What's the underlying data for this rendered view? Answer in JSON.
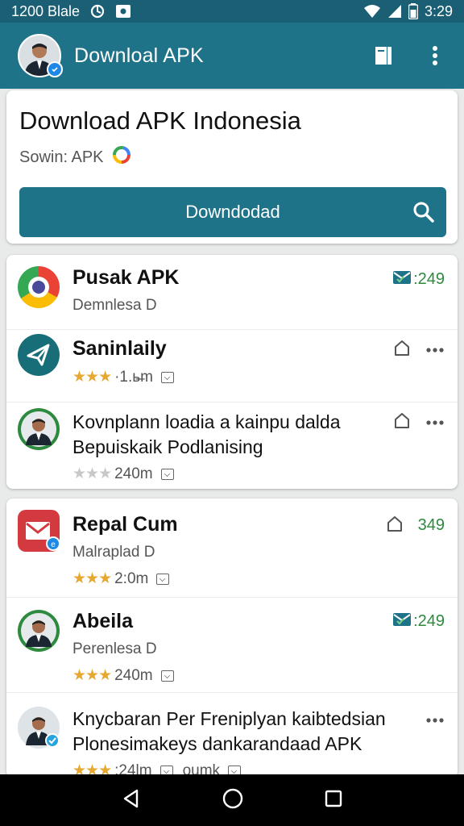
{
  "status": {
    "time_left": "1200 Blale",
    "time": "3:29"
  },
  "appbar": {
    "title": "Downloal APK"
  },
  "header": {
    "title": "Download APK Indonesia",
    "subtitle": "Sowin: APK",
    "button_label": "Downdodad"
  },
  "items": [
    {
      "title": "Pusak APK",
      "subtitle": "Demnlesa D",
      "count": ":249",
      "icon": "chrome-like-icon"
    },
    {
      "title": "Saninlaily",
      "stars_text": "★★★",
      "meta": "·1.ь̶m",
      "icon": "paper-plane-icon"
    },
    {
      "title": "Kovnplann loadia a kainpu dalda Bepuiskaik Podlanising",
      "stars_text": "★★★",
      "meta": "240m",
      "icon": "person-avatar"
    },
    {
      "title": "Repal Cum",
      "subtitle": "Malraplad D",
      "count": "349",
      "stars_text": "★★★",
      "meta": "2:0m",
      "icon": "mail-app-icon"
    },
    {
      "title": "Abeila",
      "subtitle": "Perenlesa D",
      "count": ":249",
      "stars_text": "★★★",
      "meta": "240m",
      "icon": "person-avatar"
    },
    {
      "title": "Knycbaran Per Freniplyan kaibtedsian Plonesimakeys dankarandaad APK",
      "stars_text": "★★★",
      "meta": ":24lm",
      "meta2": "oumk",
      "icon": "person-avatar-verified"
    }
  ],
  "colors": {
    "primary": "#1f7388",
    "status_bar": "#1b5f74",
    "green": "#2e8b3e",
    "star": "#e6a82e"
  }
}
